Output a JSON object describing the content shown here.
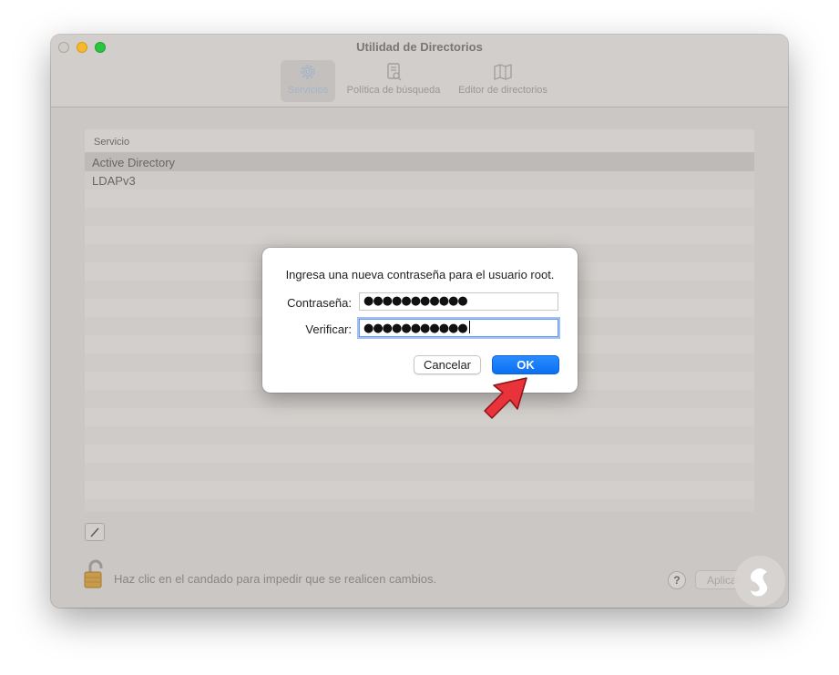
{
  "window": {
    "title": "Utilidad de Directorios"
  },
  "toolbar": {
    "items": [
      {
        "label": "Servicios",
        "icon": "gear-icon",
        "selected": true
      },
      {
        "label": "Política de búsqueda",
        "icon": "search-document-icon",
        "selected": false
      },
      {
        "label": "Editor de directorios",
        "icon": "map-icon",
        "selected": false
      }
    ]
  },
  "services_table": {
    "header": "Servicio",
    "rows": [
      "Active Directory",
      "LDAPv3"
    ],
    "selected_row": "Active Directory"
  },
  "footer": {
    "lock_text": "Haz clic en el candado para impedir que se realicen cambios.",
    "help_label": "?",
    "apply_label": "Aplicar"
  },
  "dialog": {
    "prompt": "Ingresa una nueva contraseña para el usuario root.",
    "password_label": "Contraseña:",
    "password_value": "●●●●●●●●●●●",
    "verify_label": "Verificar:",
    "verify_value": "●●●●●●●●●●●",
    "cancel_label": "Cancelar",
    "ok_label": "OK"
  },
  "colors": {
    "accent": "#0a6ff2",
    "arrow": "#e8333a"
  }
}
